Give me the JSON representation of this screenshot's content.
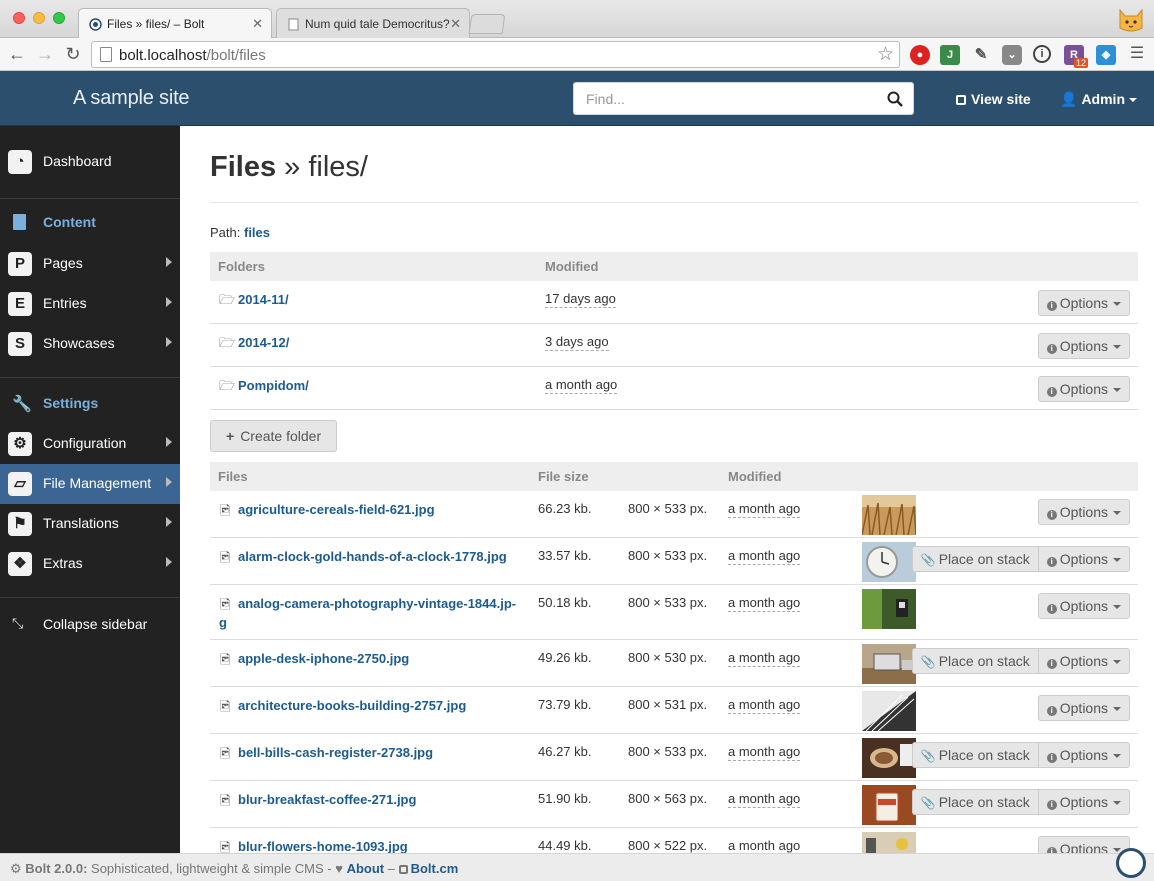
{
  "browser": {
    "tabs": [
      {
        "title": "Files » files/ – Bolt"
      },
      {
        "title": "Num quid tale Democritus?"
      }
    ],
    "url_host": "bolt.localhost",
    "url_path": "/bolt/files",
    "ext_badge_count": "12"
  },
  "header": {
    "site_title": "A sample site",
    "search_placeholder": "Find...",
    "view_site": "View site",
    "user": "Admin"
  },
  "sidebar": {
    "dashboard": "Dashboard",
    "content_heading": "Content",
    "items": [
      {
        "letter": "P",
        "label": "Pages"
      },
      {
        "letter": "E",
        "label": "Entries"
      },
      {
        "letter": "S",
        "label": "Showcases"
      }
    ],
    "settings_heading": "Settings",
    "settings_items": [
      {
        "label": "Configuration"
      },
      {
        "label": "File Management"
      },
      {
        "label": "Translations"
      },
      {
        "label": "Extras"
      }
    ],
    "collapse": "Collapse sidebar"
  },
  "main": {
    "title_bold": "Files",
    "title_rest": " » files/",
    "path_label": "Path:",
    "path_value": "files",
    "folders_header": {
      "name": "Folders",
      "modified": "Modified"
    },
    "folders": [
      {
        "name": "2014-11/",
        "modified": "17 days ago",
        "options": "Options"
      },
      {
        "name": "2014-12/",
        "modified": "3 days ago",
        "options": "Options"
      },
      {
        "name": "Pompidom/",
        "modified": "a month ago",
        "options": "Options"
      }
    ],
    "create_folder": "Create folder",
    "files_header": {
      "name": "Files",
      "size": "File size",
      "modified": "Modified"
    },
    "place_on_stack": "Place on stack",
    "files": [
      {
        "name": "agriculture-cereals-field-621.jpg",
        "size": "66.23 kb.",
        "dims": "800 × 533 px.",
        "modified": "a month ago",
        "stack": false,
        "options": "Options"
      },
      {
        "name": "alarm-clock-gold-hands-of-a-clock-1778.jpg",
        "size": "33.57 kb.",
        "dims": "800 × 533 px.",
        "modified": "a month ago",
        "stack": true,
        "options": "Options"
      },
      {
        "name": "analog-camera-photography-vintage-1844.jp-",
        "name2": "g",
        "size": "50.18 kb.",
        "dims": "800 × 533 px.",
        "modified": "a month ago",
        "stack": false,
        "options": "Options"
      },
      {
        "name": "apple-desk-iphone-2750.jpg",
        "size": "49.26 kb.",
        "dims": "800 × 530 px.",
        "modified": "a month ago",
        "stack": true,
        "options": "Options"
      },
      {
        "name": "architecture-books-building-2757.jpg",
        "size": "73.79 kb.",
        "dims": "800 × 531 px.",
        "modified": "a month ago",
        "stack": false,
        "options": "Options"
      },
      {
        "name": "bell-bills-cash-register-2738.jpg",
        "size": "46.27 kb.",
        "dims": "800 × 533 px.",
        "modified": "a month ago",
        "stack": true,
        "options": "Options"
      },
      {
        "name": "blur-breakfast-coffee-271.jpg",
        "size": "51.90 kb.",
        "dims": "800 × 563 px.",
        "modified": "a month ago",
        "stack": true,
        "options": "Options"
      },
      {
        "name": "blur-flowers-home-1093.jpg",
        "size": "44.49 kb.",
        "dims": "800 × 522 px.",
        "modified": "a month ago",
        "stack": false,
        "options": "Options"
      }
    ]
  },
  "footer": {
    "version": "Bolt 2.0.0:",
    "tagline": " Sophisticated, lightweight & simple CMS - ",
    "about": "About",
    "sep": " – ",
    "site": "Bolt.cm"
  },
  "colors": {
    "header_bg": "#2d4f6e",
    "sidebar_bg": "#222222",
    "sidebar_active": "#3b6592",
    "link": "#1d5b8e",
    "section_heading": "#7ab0de"
  }
}
